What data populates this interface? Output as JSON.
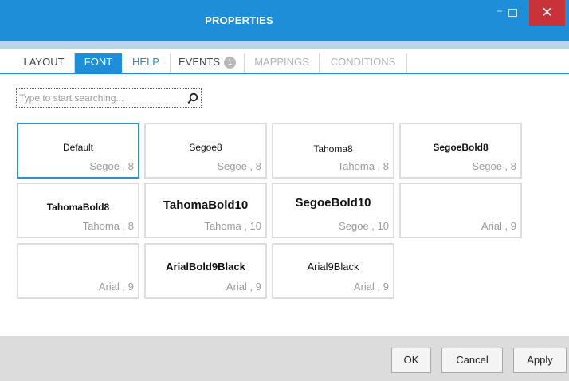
{
  "window": {
    "title": "PROPERTIES",
    "minimize_icon": "minimize-icon",
    "maximize_icon": "maximize-icon",
    "close_glyph": "✕",
    "minimize_glyph": "–",
    "accent": "#1e8ed8"
  },
  "tabs": [
    {
      "label": "LAYOUT",
      "state": "normal"
    },
    {
      "label": "FONT",
      "state": "active"
    },
    {
      "label": "HELP",
      "state": "link"
    },
    {
      "label": "EVENTS",
      "badge": "1",
      "state": "normal"
    },
    {
      "label": "MAPPINGS",
      "state": "disabled"
    },
    {
      "label": "CONDITIONS",
      "state": "disabled"
    }
  ],
  "search": {
    "placeholder": "Type to start searching...",
    "value": "",
    "icon": "search-icon"
  },
  "fonts": [
    {
      "name": "Default",
      "font": "Segoe , 8",
      "selected": true,
      "bold": false
    },
    {
      "name": "Segoe8",
      "font": "Segoe , 8",
      "bold": false
    },
    {
      "name": "Tahoma8",
      "font": "Tahoma , 8",
      "bold": false
    },
    {
      "name": "SegoeBold8",
      "font": "Segoe , 8",
      "bold": true
    },
    {
      "name": "TahomaBold8",
      "font": "Tahoma , 8",
      "bold": true
    },
    {
      "name": "TahomaBold10",
      "font": "Tahoma , 10",
      "bold": true
    },
    {
      "name": "SegoeBold10",
      "font": "Segoe , 10",
      "bold": true
    },
    {
      "name": "",
      "font": "Arial , 9",
      "bold": false
    },
    {
      "name": "",
      "font": "Arial , 9",
      "bold": false
    },
    {
      "name": "ArialBold9Black",
      "font": "Arial , 9",
      "bold": true
    },
    {
      "name": "Arial9Black",
      "font": "Arial , 9",
      "bold": false
    }
  ],
  "buttons": {
    "ok": "OK",
    "cancel": "Cancel",
    "apply": "Apply"
  }
}
